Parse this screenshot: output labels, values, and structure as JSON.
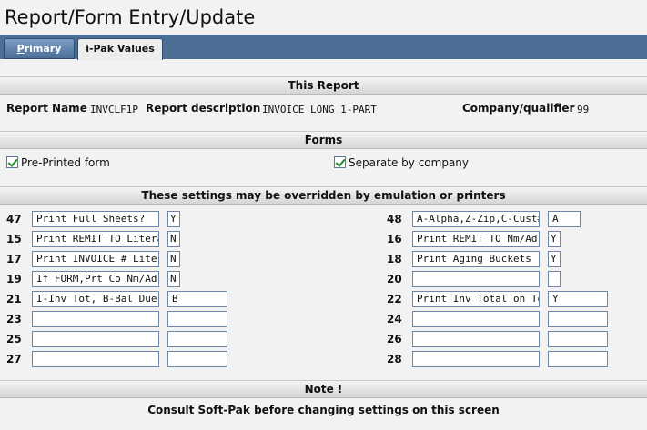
{
  "window": {
    "title": "Report/Form Entry/Update"
  },
  "tabs": [
    {
      "label_u": "P",
      "label_rest": "rimary"
    },
    {
      "label": "i-Pak Values"
    }
  ],
  "this_report": {
    "header": "This Report",
    "report_name_label": "Report Name",
    "report_name": "INVCLF1P",
    "description_label": "Report description",
    "description": "INVOICE LONG 1-PART",
    "company_label": "Company/qualifier",
    "company": "99"
  },
  "forms": {
    "header": "Forms",
    "preprinted_label": "Pre-Printed form",
    "separate_label": "Separate by company"
  },
  "settings": {
    "header": "These settings may be overridden by emulation or printers",
    "left": [
      {
        "num": "47",
        "desc": "Print Full Sheets?",
        "value": "Y"
      },
      {
        "num": "15",
        "desc": "Print REMIT TO Literal",
        "value": "N"
      },
      {
        "num": "17",
        "desc": "Print INVOICE # Literl",
        "value": "N"
      },
      {
        "num": "19",
        "desc": "If FORM,Prt Co Nm/Adrs",
        "value": "N"
      },
      {
        "num": "21",
        "desc": "I-Inv Tot, B-Bal Due",
        "value": "B"
      },
      {
        "num": "23",
        "desc": "",
        "value": ""
      },
      {
        "num": "25",
        "desc": "",
        "value": ""
      },
      {
        "num": "27",
        "desc": "",
        "value": ""
      }
    ],
    "right": [
      {
        "num": "48",
        "desc": "A-Alpha,Z-Zip,C-Cust#",
        "value": "A"
      },
      {
        "num": "16",
        "desc": "Print REMIT TO Nm/Adrs",
        "value": "Y"
      },
      {
        "num": "18",
        "desc": "Print Aging Buckets",
        "value": "Y"
      },
      {
        "num": "20",
        "desc": "",
        "value": ""
      },
      {
        "num": "22",
        "desc": "Print Inv Total on Top",
        "value": "Y"
      },
      {
        "num": "24",
        "desc": "",
        "value": ""
      },
      {
        "num": "26",
        "desc": "",
        "value": ""
      },
      {
        "num": "28",
        "desc": "",
        "value": ""
      }
    ]
  },
  "note": {
    "header": "Note !",
    "text": "Consult Soft-Pak before changing settings on this screen"
  }
}
